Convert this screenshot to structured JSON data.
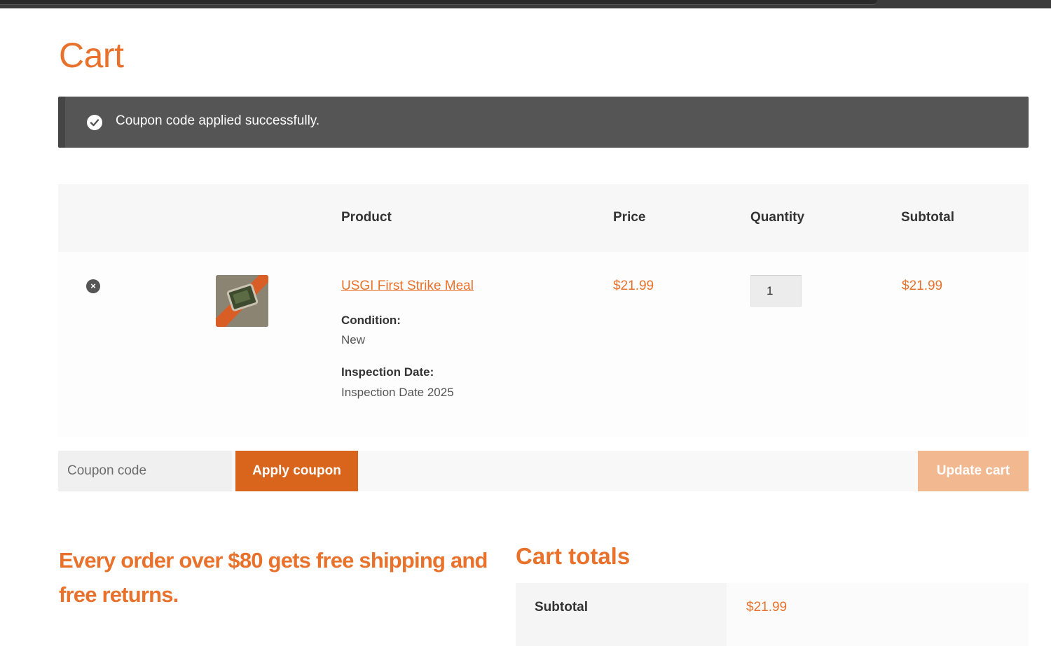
{
  "page": {
    "title": "Cart"
  },
  "notice": {
    "message": "Coupon code applied successfully."
  },
  "table": {
    "headers": {
      "product": "Product",
      "price": "Price",
      "quantity": "Quantity",
      "subtotal": "Subtotal"
    },
    "rows": [
      {
        "remove_icon": "close-circle-icon",
        "product_name": "USGI First Strike Meal",
        "meta": [
          {
            "label": "Condition:",
            "value": "New"
          },
          {
            "label": "Inspection Date:",
            "value": "Inspection Date 2025"
          }
        ],
        "price": "$21.99",
        "quantity": "1",
        "subtotal": "$21.99"
      }
    ]
  },
  "actions": {
    "coupon_placeholder": "Coupon code",
    "apply_label": "Apply coupon",
    "update_label": "Update cart"
  },
  "promo": {
    "text": "Every order over $80 gets free shipping and free returns."
  },
  "totals": {
    "title": "Cart totals",
    "rows": [
      {
        "label": "Subtotal",
        "value": "$21.99"
      }
    ]
  },
  "colors": {
    "accent": "#e8722c",
    "button": "#d9651d",
    "button_disabled": "#f2b88f",
    "notice_bg": "#555555"
  }
}
